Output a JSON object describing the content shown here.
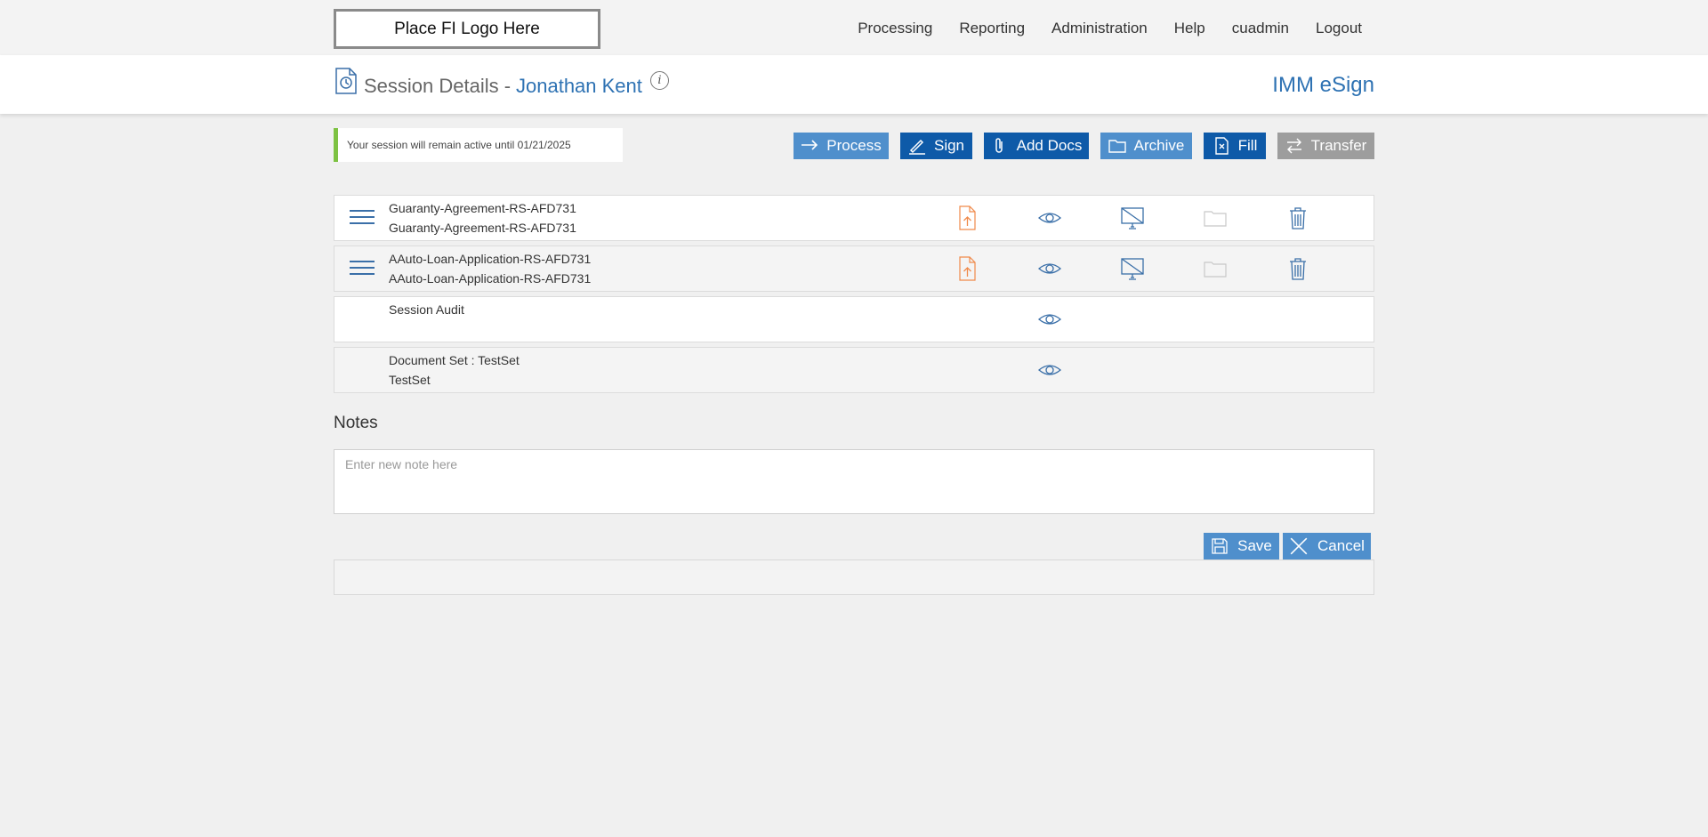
{
  "header": {
    "logo_text": "Place FI Logo Here",
    "nav": [
      "Processing",
      "Reporting",
      "Administration",
      "Help",
      "cuadmin",
      "Logout"
    ]
  },
  "title": {
    "label": "Session Details -",
    "name": "Jonathan Kent",
    "info_glyph": "i",
    "brand": "IMM eSign"
  },
  "notice": "Your session will remain active until 01/21/2025",
  "actions": {
    "process": "Process",
    "sign": "Sign",
    "add_docs": "Add Docs",
    "archive": "Archive",
    "fill": "Fill",
    "transfer": "Transfer"
  },
  "documents": [
    {
      "line1": "Guaranty-Agreement-RS-AFD731",
      "line2": "Guaranty-Agreement-RS-AFD731"
    },
    {
      "line1": "AAuto-Loan-Application-RS-AFD731",
      "line2": "AAuto-Loan-Application-RS-AFD731"
    },
    {
      "line1": "Session Audit",
      "line2": ""
    },
    {
      "line1": "Document Set : TestSet",
      "line2": "TestSet"
    }
  ],
  "notes": {
    "title": "Notes",
    "placeholder": "Enter new note here",
    "save": "Save",
    "cancel": "Cancel"
  },
  "colors": {
    "accent": "#2e72b3",
    "button_light": "#4f8fcc",
    "button_dark": "#0e5aa8",
    "button_disabled": "#9d9d9d",
    "notice_border": "#7dc242",
    "upload_icon": "#f08a4b"
  }
}
